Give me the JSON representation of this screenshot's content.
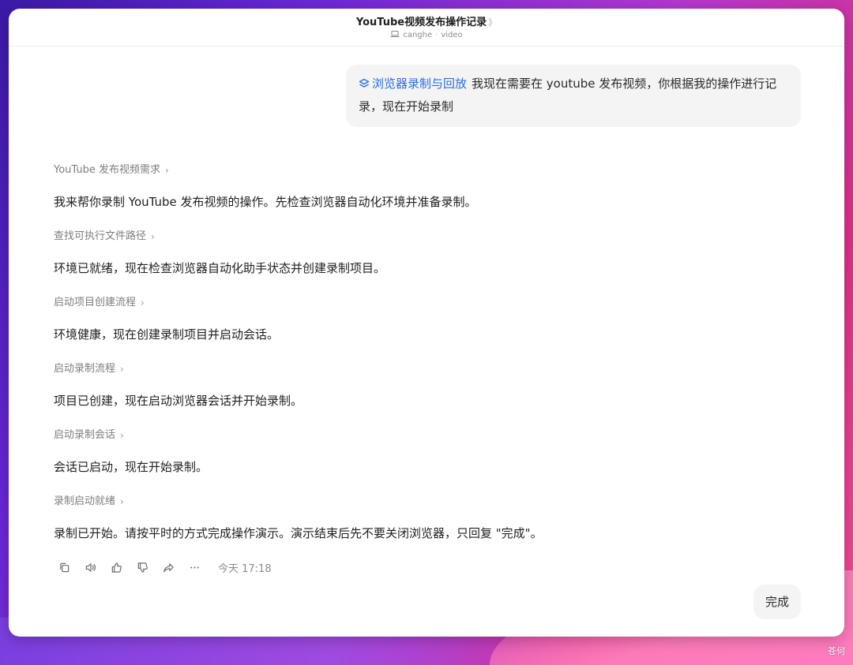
{
  "window": {
    "title": "YouTube视频发布操作记录",
    "title_chevron": "》",
    "subtitle_user": "canghe",
    "subtitle_sep": "·",
    "subtitle_project": "video"
  },
  "user_message": {
    "skill_label": "浏览器录制与回放",
    "text": "我现在需要在 youtube 发布视频，你根据我的操作进行记录，现在开始录制"
  },
  "assistant": {
    "steps": [
      {
        "title": "YouTube 发布视频需求",
        "text": "我来帮你录制 YouTube 发布视频的操作。先检查浏览器自动化环境并准备录制。"
      },
      {
        "title": "查找可执行文件路径",
        "text": "环境已就绪，现在检查浏览器自动化助手状态并创建录制项目。"
      },
      {
        "title": "启动项目创建流程",
        "text": "环境健康，现在创建录制项目并启动会话。"
      },
      {
        "title": "启动录制流程",
        "text": "项目已创建，现在启动浏览器会话并开始录制。"
      },
      {
        "title": "启动录制会话",
        "text": "会话已启动，现在开始录制。"
      },
      {
        "title": "录制启动就绪",
        "text": "录制已开始。请按平时的方式完成操作演示。演示结束后先不要关闭浏览器，只回复 \"完成\"。"
      }
    ],
    "timestamp": "今天 17:18",
    "action_icons": [
      "copy-icon",
      "speaker-icon",
      "thumbs-up-icon",
      "thumbs-down-icon",
      "share-icon",
      "more-icon"
    ]
  },
  "user_reply": {
    "text": "完成"
  },
  "watermark": "苍何",
  "colors": {
    "accent": "#2a6fe0",
    "bubble": "#f4f4f5"
  }
}
